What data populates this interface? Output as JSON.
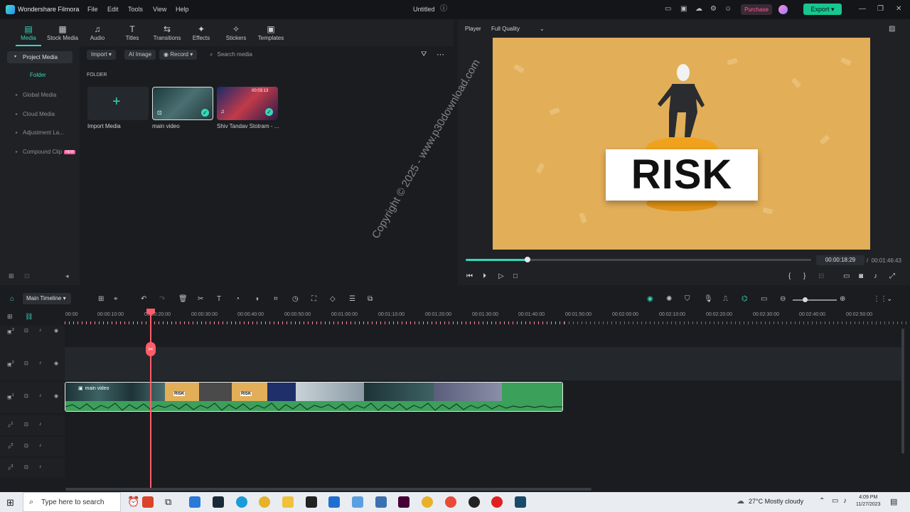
{
  "app": {
    "name": "Wondershare Filmora",
    "document": "Untitled"
  },
  "menu": [
    "File",
    "Edit",
    "Tools",
    "View",
    "Help"
  ],
  "header": {
    "purchase_label": "Purchase",
    "export_label": "Export"
  },
  "toptabs": [
    {
      "label": "Media",
      "icon": "media-icon"
    },
    {
      "label": "Stock Media",
      "icon": "stock-media-icon"
    },
    {
      "label": "Audio",
      "icon": "audio-icon"
    },
    {
      "label": "Titles",
      "icon": "titles-icon"
    },
    {
      "label": "Transitions",
      "icon": "transitions-icon"
    },
    {
      "label": "Effects",
      "icon": "effects-icon"
    },
    {
      "label": "Stickers",
      "icon": "stickers-icon"
    },
    {
      "label": "Templates",
      "icon": "templates-icon"
    }
  ],
  "sidebar": {
    "project_media": "Project Media",
    "folder": "Folder",
    "items": [
      "Global Media",
      "Cloud Media",
      "Adjustment La...",
      "Compound Clip"
    ],
    "compound_badge": "NEW"
  },
  "media": {
    "import_label": "Import",
    "ai_image_label": "AI Image",
    "record_label": "Record",
    "search_placeholder": "Search media",
    "folder_label": "FOLDER",
    "items": [
      {
        "name": "Import Media"
      },
      {
        "name": "main video"
      },
      {
        "name": "Shiv Tandav Stotram - ...",
        "duration": "00:03:13"
      }
    ]
  },
  "player": {
    "label": "Player",
    "quality": "Full Quality",
    "overlay_text": "RISK",
    "current_time": "00:00:18:29",
    "total_time": "00:01:46:43",
    "progress_fraction": 0.18
  },
  "timeline": {
    "name": "Main Timeline",
    "ruler": [
      "00:00",
      "00:00:10:00",
      "00:00:20:00",
      "00:00:30:00",
      "00:00:40:00",
      "00:00:50:00",
      "00:01:00:00",
      "00:01:10:00",
      "00:01:20:00",
      "00:01:30:00",
      "00:01:40:00",
      "00:01:50:00",
      "00:02:00:00",
      "00:02:10:00",
      "00:02:20:00",
      "00:02:30:00",
      "00:02:40:00",
      "00:02:50:00"
    ],
    "clip_label": "main video",
    "tracks": [
      "3",
      "2",
      "1",
      "1",
      "2",
      "3"
    ]
  },
  "watermark": "Copyright © 2025 - www.p30download.com",
  "taskbar": {
    "search_placeholder": "Type here to search",
    "weather": "27°C  Mostly cloudy",
    "time": "4:09 PM",
    "date": "11/27/2023"
  },
  "colors": {
    "accent": "#35d7b8",
    "export": "#16c78e",
    "playhead": "#ff5c6a",
    "video_bg": "#e2ae58",
    "audio_wave": "#3aa05a"
  }
}
